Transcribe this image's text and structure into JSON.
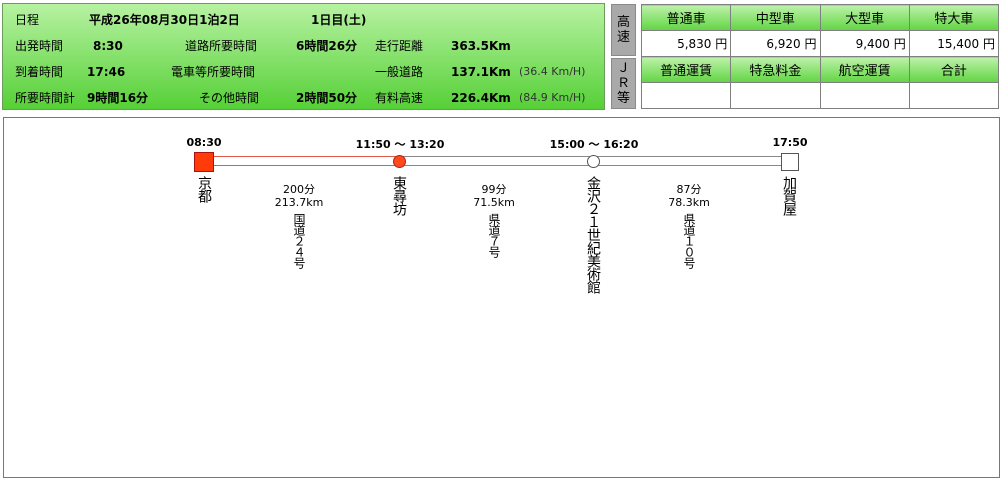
{
  "summary": {
    "schedule_label": "日程",
    "schedule_date": "平成26年08月30日1泊2日",
    "day": "1日目(土)",
    "depart_label": "出発時間",
    "depart_time": "8:30",
    "road_time_label": "道路所要時間",
    "road_time": "6時間26分",
    "distance_label": "走行距離",
    "distance": "363.5Km",
    "arrive_label": "到着時間",
    "arrive_time": "17:46",
    "train_time_label": "電車等所要時間",
    "general_road_label": "一般道路",
    "general_road_dist": "137.1Km",
    "general_road_speed": "(36.4 Km/H)",
    "total_time_label": "所要時間計",
    "total_time": "9時間16分",
    "other_time_label": "その他時間",
    "other_time": "2時間50分",
    "toll_label": "有料高速",
    "toll_dist": "226.4Km",
    "toll_speed": "(84.9 Km/H)"
  },
  "side_labels": {
    "expressway": [
      "高",
      "速"
    ],
    "jr": [
      "Ｊ",
      "Ｒ",
      "等"
    ]
  },
  "fares": {
    "vehicle_headers": [
      "普通車",
      "中型車",
      "大型車",
      "特大車"
    ],
    "vehicle_values": [
      "5,830 円",
      "6,920 円",
      "9,400 円",
      "15,400 円"
    ],
    "other_headers": [
      "普通運賃",
      "特急料金",
      "航空運賃",
      "合計"
    ],
    "other_values": [
      "",
      "",
      "",
      ""
    ]
  },
  "route": {
    "stops": [
      {
        "name": "京都",
        "time": "08:30",
        "marker": "start"
      },
      {
        "name": "東尋坊",
        "time": "11:50 ～ 13:20",
        "marker": "visited"
      },
      {
        "name": "金沢２１世紀美術館",
        "time": "15:00 ～ 16:20",
        "marker": "stop"
      },
      {
        "name": "加賀屋",
        "time": "17:50",
        "marker": "end"
      }
    ],
    "segments": [
      {
        "minutes": "200分",
        "km": "213.7km",
        "road": "国道２４号",
        "active": true
      },
      {
        "minutes": "99分",
        "km": "71.5km",
        "road": "県道７号",
        "active": false
      },
      {
        "minutes": "87分",
        "km": "78.3km",
        "road": "県道１０号",
        "active": false
      }
    ]
  },
  "colors": {
    "summary_green": "#56d037",
    "header_green": "#62d443",
    "start_red": "#ff3b0a",
    "active_segment": "#e05a4a"
  }
}
